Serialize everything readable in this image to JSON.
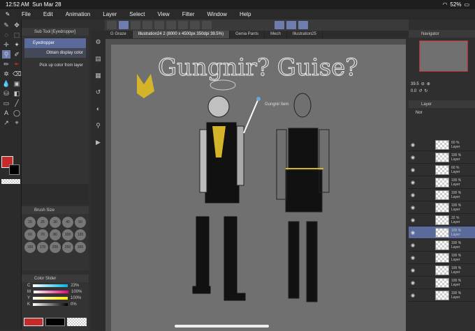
{
  "status": {
    "time": "12:52 AM",
    "date": "Sun Mar 28",
    "battery": "52%"
  },
  "menu": [
    "File",
    "Edit",
    "Animation",
    "Layer",
    "Select",
    "View",
    "Filter",
    "Window",
    "Help"
  ],
  "subtool": {
    "title": "Sub Tool [Eyedropper]",
    "selected": "Eyedropper",
    "desc1": "Obtain display color",
    "desc2": "Pick up color from layer"
  },
  "tabs": [
    "G Graze",
    "Illustration24 2 (8000 x 4500px 350dpi 39.5%)",
    "Genia Pants",
    "Mech",
    "Illustration25"
  ],
  "canvas": {
    "title_text": "Gungnir? Guise?",
    "annotation": "Gungnir item"
  },
  "navigator": {
    "title": "Navigator",
    "zoom": "39.5",
    "angle": "0.0"
  },
  "layer_panel": {
    "title": "Layer",
    "blend": "Nor",
    "rows": [
      {
        "opacity": "60 %",
        "name": "Layer"
      },
      {
        "opacity": "100 %",
        "name": "Layer"
      },
      {
        "opacity": "60 %",
        "name": "Layer"
      },
      {
        "opacity": "100 %",
        "name": "Layer"
      },
      {
        "opacity": "100 %",
        "name": "Layer"
      },
      {
        "opacity": "100 %",
        "name": "Layer"
      },
      {
        "opacity": "32 %",
        "name": "Layer"
      },
      {
        "opacity": "100 %",
        "name": "Layer"
      },
      {
        "opacity": "100 %",
        "name": "Layer"
      },
      {
        "opacity": "100 %",
        "name": "Layer"
      },
      {
        "opacity": "100 %",
        "name": "Layer"
      },
      {
        "opacity": "100 %",
        "name": "Layer"
      },
      {
        "opacity": "100 %",
        "name": "Layer"
      }
    ]
  },
  "brush_size": {
    "title": "Brush Size",
    "sizes": [
      "20",
      "25",
      "30",
      "40",
      "50",
      "60",
      "70",
      "80",
      "100",
      "120",
      "150",
      "170",
      "200",
      "250",
      "300"
    ]
  },
  "color_slider": {
    "title": "Color Slider",
    "rows": [
      {
        "label": "C",
        "value": "23%"
      },
      {
        "label": "M",
        "value": "100%"
      },
      {
        "label": "Y",
        "value": "100%"
      },
      {
        "label": "K",
        "value": "0%"
      }
    ]
  },
  "colors": {
    "main": "#c62a2a",
    "sub": "#000000",
    "accent": "#6d7db0",
    "canvas": "#707070"
  }
}
